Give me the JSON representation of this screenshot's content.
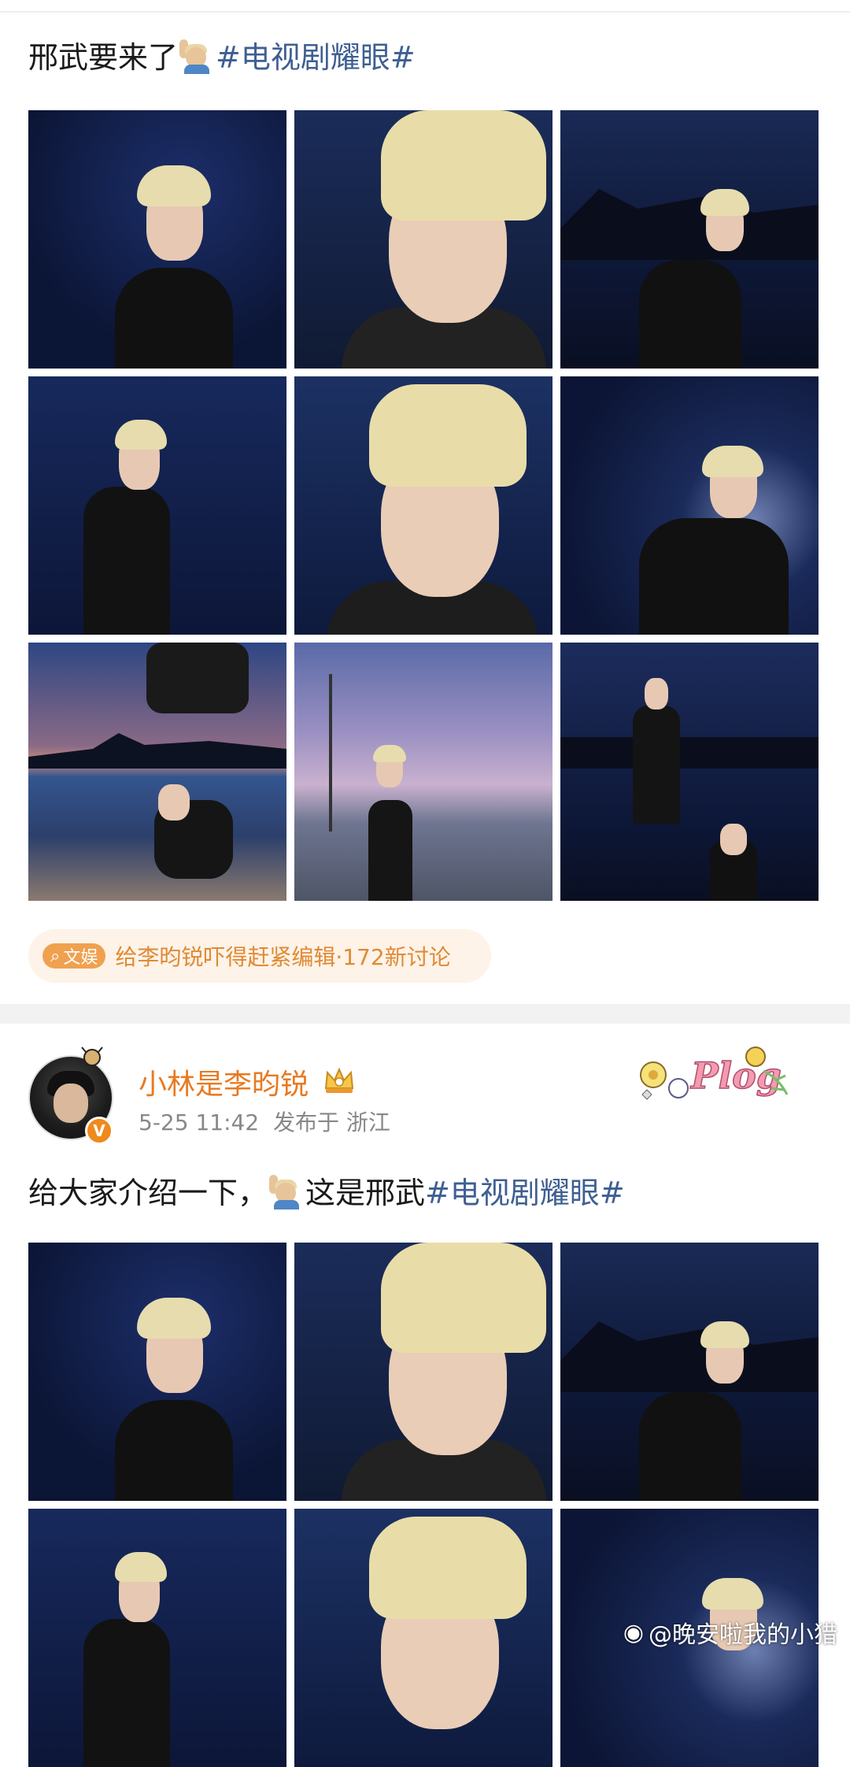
{
  "post1": {
    "text": "邢武要来了",
    "hashtag": "#电视剧耀眼#",
    "topic": {
      "tag_label": "文娱",
      "text": "给李昀锐吓得赶紧编辑·172新讨论"
    }
  },
  "post2": {
    "username": "小林是李昀锐",
    "timestamp": "5-25 11:42",
    "location": "发布于 浙江",
    "text_before": "给大家介绍一下，",
    "text_after": "这是邢武",
    "hashtag": "#电视剧耀眼#",
    "sticker_text": "Plog"
  },
  "watermark": "@晚安啦我的小猎",
  "colors": {
    "hashtag": "#3f5f92",
    "username": "#e87a22",
    "topic": "#e08a34",
    "verify": "#f08a1c"
  }
}
